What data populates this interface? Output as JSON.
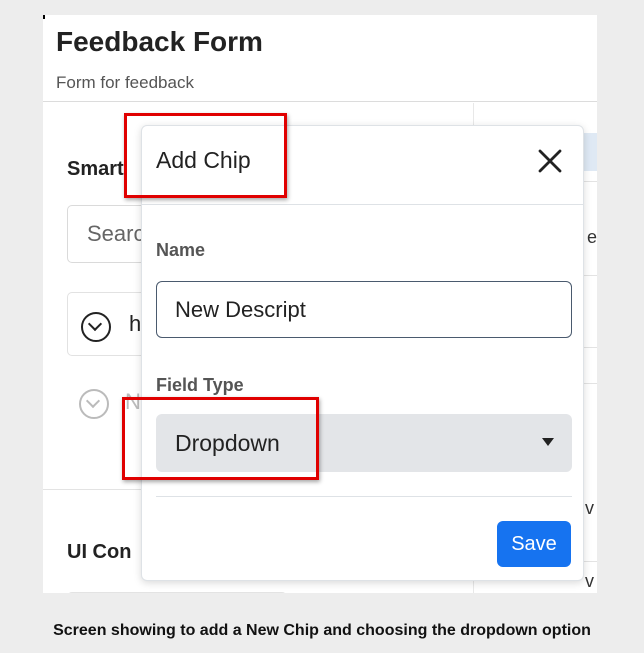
{
  "app": {
    "title": "Feedback Form",
    "subtitle": "Form for feedback"
  },
  "left_panel": {
    "smart_heading": "Smart",
    "search_placeholder": "Search",
    "item_letter": "h",
    "muted_item_letter": "N",
    "ui_heading": "UI Con"
  },
  "right_panel": {
    "letters": [
      "e",
      "v",
      "v"
    ]
  },
  "modal": {
    "title": "Add Chip",
    "close_icon": "close-icon",
    "name_label": "Name",
    "name_value": "New Descript",
    "field_type_label": "Field Type",
    "field_type_value": "Dropdown",
    "save_label": "Save"
  },
  "annotation": {
    "highlight_color": "#e00000"
  },
  "caption": "Screen showing to add a New Chip and choosing the dropdown option",
  "colors": {
    "primary_button": "#1673f0",
    "select_bg": "#e3e5e8"
  }
}
